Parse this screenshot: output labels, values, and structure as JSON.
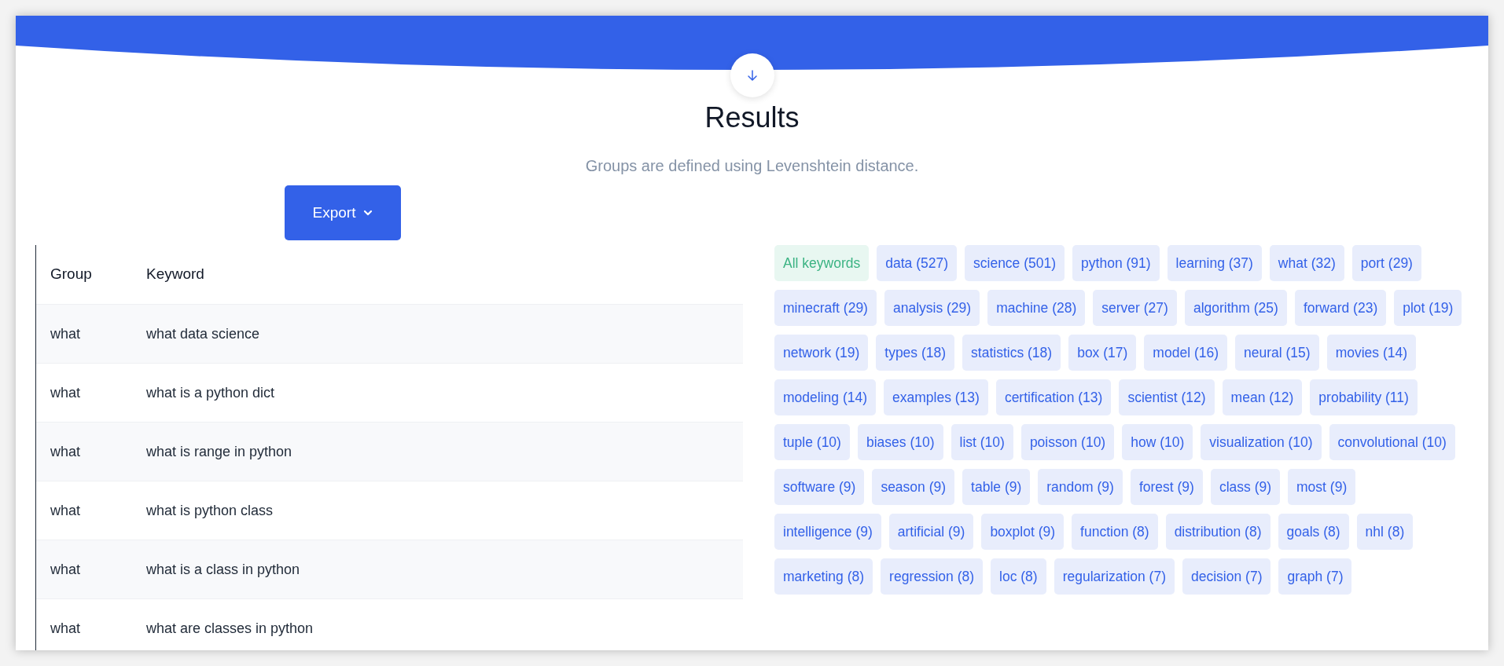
{
  "title": "Results",
  "subtitle": "Groups are defined using Levenshtein distance.",
  "export_button": {
    "label": "Export"
  },
  "table": {
    "columns": [
      "Group",
      "Keyword"
    ],
    "rows": [
      {
        "group": "what",
        "keyword": "what data science"
      },
      {
        "group": "what",
        "keyword": "what is a python dict"
      },
      {
        "group": "what",
        "keyword": "what is range in python"
      },
      {
        "group": "what",
        "keyword": "what is python class"
      },
      {
        "group": "what",
        "keyword": "what is a class in python"
      },
      {
        "group": "what",
        "keyword": "what are classes in python"
      }
    ]
  },
  "tags": [
    {
      "label": "All keywords",
      "selected": true
    },
    {
      "label": "data (527)",
      "selected": false
    },
    {
      "label": "science (501)",
      "selected": false
    },
    {
      "label": "python (91)",
      "selected": false
    },
    {
      "label": "learning (37)",
      "selected": false
    },
    {
      "label": "what (32)",
      "selected": false
    },
    {
      "label": "port (29)",
      "selected": false
    },
    {
      "label": "minecraft (29)",
      "selected": false
    },
    {
      "label": "analysis (29)",
      "selected": false
    },
    {
      "label": "machine (28)",
      "selected": false
    },
    {
      "label": "server (27)",
      "selected": false
    },
    {
      "label": "algorithm (25)",
      "selected": false
    },
    {
      "label": "forward (23)",
      "selected": false
    },
    {
      "label": "plot (19)",
      "selected": false
    },
    {
      "label": "network (19)",
      "selected": false
    },
    {
      "label": "types (18)",
      "selected": false
    },
    {
      "label": "statistics (18)",
      "selected": false
    },
    {
      "label": "box (17)",
      "selected": false
    },
    {
      "label": "model (16)",
      "selected": false
    },
    {
      "label": "neural (15)",
      "selected": false
    },
    {
      "label": "movies (14)",
      "selected": false
    },
    {
      "label": "modeling (14)",
      "selected": false
    },
    {
      "label": "examples (13)",
      "selected": false
    },
    {
      "label": "certification (13)",
      "selected": false
    },
    {
      "label": "scientist (12)",
      "selected": false
    },
    {
      "label": "mean (12)",
      "selected": false
    },
    {
      "label": "probability (11)",
      "selected": false
    },
    {
      "label": "tuple (10)",
      "selected": false
    },
    {
      "label": "biases (10)",
      "selected": false
    },
    {
      "label": "list (10)",
      "selected": false
    },
    {
      "label": "poisson (10)",
      "selected": false
    },
    {
      "label": "how (10)",
      "selected": false
    },
    {
      "label": "visualization (10)",
      "selected": false
    },
    {
      "label": "convolutional (10)",
      "selected": false
    },
    {
      "label": "software (9)",
      "selected": false
    },
    {
      "label": "season (9)",
      "selected": false
    },
    {
      "label": "table (9)",
      "selected": false
    },
    {
      "label": "random (9)",
      "selected": false
    },
    {
      "label": "forest (9)",
      "selected": false
    },
    {
      "label": "class (9)",
      "selected": false
    },
    {
      "label": "most (9)",
      "selected": false
    },
    {
      "label": "intelligence (9)",
      "selected": false
    },
    {
      "label": "artificial (9)",
      "selected": false
    },
    {
      "label": "boxplot (9)",
      "selected": false
    },
    {
      "label": "function (8)",
      "selected": false
    },
    {
      "label": "distribution (8)",
      "selected": false
    },
    {
      "label": "goals (8)",
      "selected": false
    },
    {
      "label": "nhl (8)",
      "selected": false
    },
    {
      "label": "marketing (8)",
      "selected": false
    },
    {
      "label": "regression (8)",
      "selected": false
    },
    {
      "label": "loc (8)",
      "selected": false
    },
    {
      "label": "regularization (7)",
      "selected": false
    },
    {
      "label": "decision (7)",
      "selected": false
    },
    {
      "label": "graph (7)",
      "selected": false
    }
  ]
}
